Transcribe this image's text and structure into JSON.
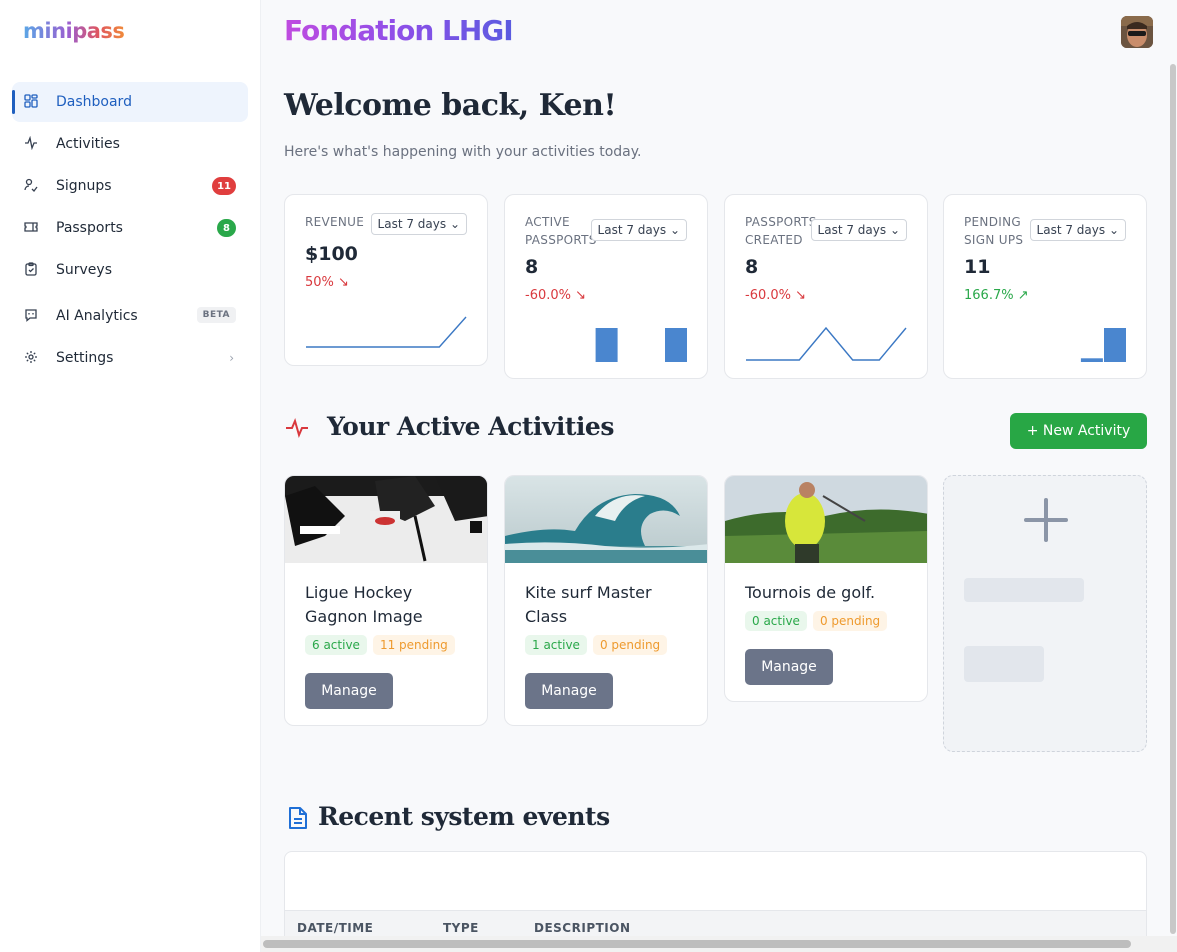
{
  "app": {
    "logo_text": "minipass"
  },
  "sidebar": {
    "items": [
      {
        "label": "Dashboard",
        "icon": "dashboard-icon",
        "active": true
      },
      {
        "label": "Activities",
        "icon": "activity-icon"
      },
      {
        "label": "Signups",
        "icon": "user-check-icon",
        "badge": "11",
        "badge_color": "#e03e3e"
      },
      {
        "label": "Passports",
        "icon": "ticket-icon",
        "badge": "8",
        "badge_color": "#2aa84a"
      },
      {
        "label": "Surveys",
        "icon": "clipboard-icon"
      },
      {
        "label": "AI Analytics",
        "icon": "chat-icon",
        "tag": "BETA"
      },
      {
        "label": "Settings",
        "icon": "gear-icon",
        "chevron": "›"
      }
    ]
  },
  "header": {
    "org_name": "Fondation LHGI",
    "avatar": "user-avatar"
  },
  "main": {
    "welcome": "Welcome back, Ken!",
    "subtitle": "Here's what's happening with your activities today."
  },
  "kpis": [
    {
      "label": "REVENUE",
      "period": "Last 7 days ⌄",
      "value": "$100",
      "change": "50%",
      "trend": "down",
      "chart": "line",
      "series": [
        0,
        0,
        0,
        0,
        0,
        0,
        1
      ]
    },
    {
      "label": "ACTIVE PASSPORTS",
      "period": "Last 7 days ⌄",
      "value": "8",
      "change": "-60.0%",
      "trend": "down",
      "chart": "bar",
      "series": [
        0,
        0,
        0,
        1,
        0,
        0,
        1
      ]
    },
    {
      "label": "PASSPORTS CREATED",
      "period": "Last 7 days ⌄",
      "value": "8",
      "change": "-60.0%",
      "trend": "down",
      "chart": "line",
      "series": [
        0,
        0,
        0,
        1,
        0,
        0,
        1
      ]
    },
    {
      "label": "PENDING SIGN UPS",
      "period": "Last 7 days ⌄",
      "value": "11",
      "change": "166.7%",
      "trend": "up",
      "chart": "bar",
      "series": [
        0,
        0,
        0,
        0,
        0,
        0.11,
        1
      ]
    }
  ],
  "activities_section": {
    "title": "Your Active Activities",
    "new_button": "+ New Activity",
    "cards": [
      {
        "title": "Ligue Hockey Gagnon Image",
        "active": "6 active",
        "pending": "11 pending",
        "manage": "Manage",
        "image": "hockey-image"
      },
      {
        "title": "Kite surf Master Class",
        "active": "1 active",
        "pending": "0 pending",
        "manage": "Manage",
        "image": "wave-image"
      },
      {
        "title": "Tournois de golf.",
        "active": "0 active",
        "pending": "0 pending",
        "manage": "Manage",
        "image": "golf-image"
      }
    ]
  },
  "events_section": {
    "title": "Recent system events",
    "columns": [
      "DATE/TIME",
      "TYPE",
      "DESCRIPTION"
    ]
  }
}
